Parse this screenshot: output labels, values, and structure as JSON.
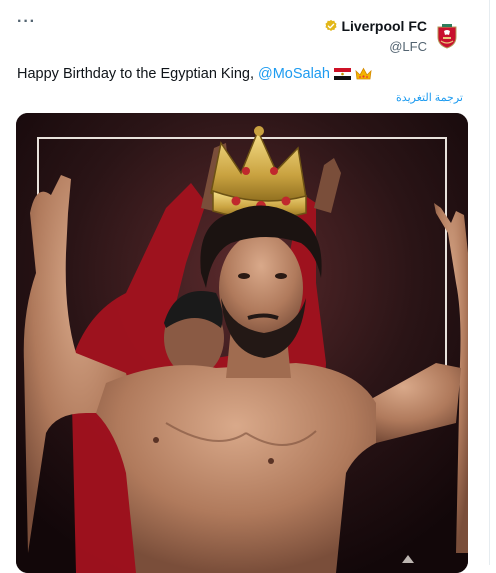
{
  "tweet": {
    "author_name": "Liverpool FC",
    "author_handle": "@LFC",
    "text": "Happy Birthday to the Egyptian King, ",
    "mention": "@MoSalah",
    "translate_label": "ترجمة التغريدة",
    "more_glyph": "···"
  },
  "icons": {
    "more": "more-horizontal-icon",
    "verified": "gold-verified-badge-icon",
    "avatar": "lfc-crest-icon",
    "flag": "egypt-flag-emoji",
    "crown": "crown-emoji"
  },
  "colors": {
    "link": "#1d9bf0",
    "verified_gold": "#e2b719",
    "lfc_red": "#c8102e"
  }
}
